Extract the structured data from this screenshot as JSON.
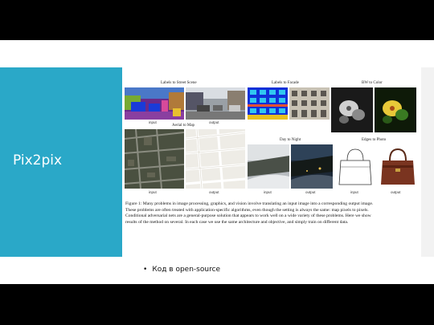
{
  "slide": {
    "title": "Pix2pix",
    "bullet": "Код в open-source"
  },
  "figure": {
    "panels": {
      "street": "Labels to Street Scene",
      "facade": "Labels to Facade",
      "bw": "BW to Color",
      "aerial": "Aerial to Map",
      "day": "Day to Night",
      "edges": "Edges to Photo"
    },
    "io": {
      "input": "input",
      "output": "output"
    },
    "caption_lines": [
      "Figure 1: Many problems in image processing, graphics, and vision involve translating an input image into a corresponding output image.",
      "These problems are often treated with application-specific algorithms, even though the setting is always the same: map pixels to pixels.",
      "Conditional adversarial nets are a general-purpose solution that appears to work well on a wide variety of these problems. Here we show",
      "results of the method on several. In each case we use the same architecture and objective, and simply train on different data."
    ]
  },
  "colors": {
    "title_band": "#2aa8c8",
    "background": "#000000"
  }
}
